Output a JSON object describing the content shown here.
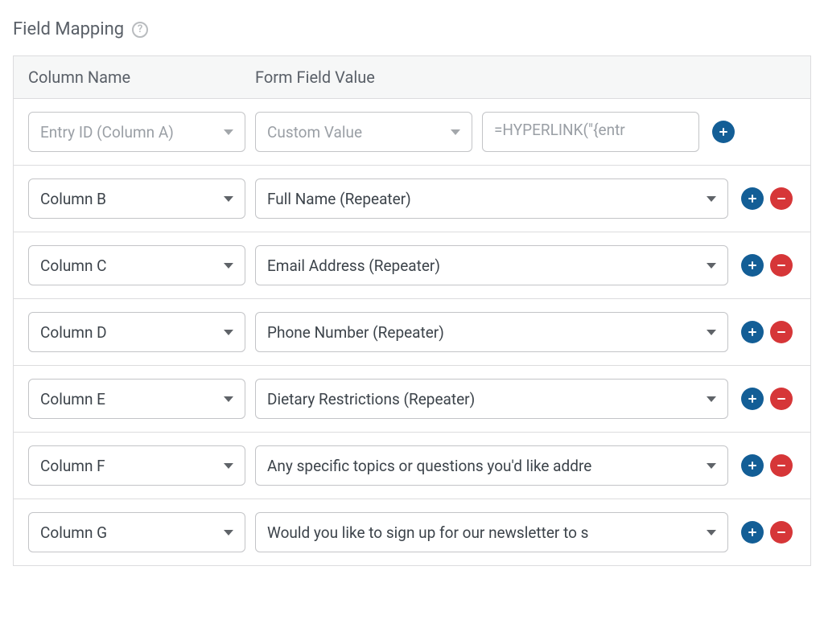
{
  "section_title": "Field Mapping",
  "headers": {
    "column_name": "Column Name",
    "form_field_value": "Form Field Value"
  },
  "rows": [
    {
      "column_name": "Entry ID (Column A)",
      "column_placeholder": true,
      "form_field": "Custom Value",
      "form_field_placeholder": true,
      "has_custom_input": true,
      "custom_value": "=HYPERLINK(\"{entr",
      "show_remove": false
    },
    {
      "column_name": "Column B",
      "column_placeholder": false,
      "form_field": "Full Name (Repeater)",
      "form_field_placeholder": false,
      "has_custom_input": false,
      "show_remove": true
    },
    {
      "column_name": "Column C",
      "column_placeholder": false,
      "form_field": "Email Address (Repeater)",
      "form_field_placeholder": false,
      "has_custom_input": false,
      "show_remove": true
    },
    {
      "column_name": "Column D",
      "column_placeholder": false,
      "form_field": "Phone Number (Repeater)",
      "form_field_placeholder": false,
      "has_custom_input": false,
      "show_remove": true
    },
    {
      "column_name": "Column E",
      "column_placeholder": false,
      "form_field": "Dietary Restrictions (Repeater)",
      "form_field_placeholder": false,
      "has_custom_input": false,
      "show_remove": true
    },
    {
      "column_name": "Column F",
      "column_placeholder": false,
      "form_field": "Any specific topics or questions you'd like addre",
      "form_field_placeholder": false,
      "has_custom_input": false,
      "show_remove": true
    },
    {
      "column_name": "Column G",
      "column_placeholder": false,
      "form_field": "Would you like to sign up for our newsletter to s",
      "form_field_placeholder": false,
      "has_custom_input": false,
      "show_remove": true
    }
  ]
}
